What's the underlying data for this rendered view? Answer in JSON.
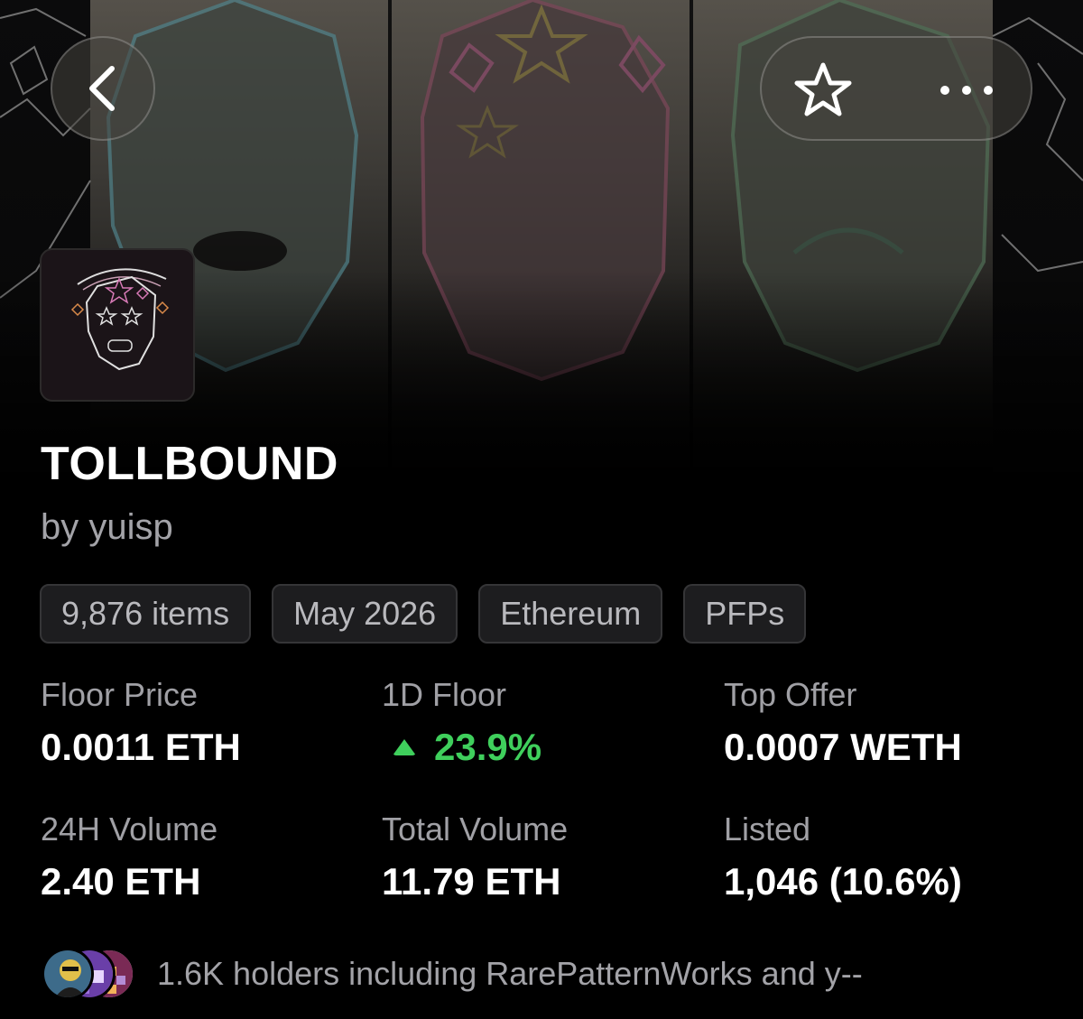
{
  "nav": {
    "back_icon": "chevron-left-icon",
    "favorite_icon": "star-outline-icon",
    "more_icon": "more-horizontal-icon"
  },
  "collection": {
    "name": "TOLLBOUND",
    "creator": "by yuisp",
    "chips": [
      "9,876 items",
      "May 2026",
      "Ethereum",
      "PFPs"
    ]
  },
  "stats": {
    "floor_price": {
      "label": "Floor Price",
      "value": "0.0011 ETH"
    },
    "floor_1d": {
      "label": "1D Floor",
      "value": "23.9%",
      "direction": "up"
    },
    "top_offer": {
      "label": "Top Offer",
      "value": "0.0007 WETH"
    },
    "volume_24h": {
      "label": "24H Volume",
      "value": "2.40 ETH"
    },
    "total_volume": {
      "label": "Total Volume",
      "value": "11.79 ETH"
    },
    "listed": {
      "label": "Listed",
      "value": "1,046 (10.6%)"
    }
  },
  "holders": {
    "text": "1.6K holders including RarePatternWorks and y--"
  },
  "colors": {
    "background": "#000000",
    "positive": "#3fcf5c",
    "muted_text": "#a3a3a8",
    "chip_bg": "#1d1d1f"
  }
}
